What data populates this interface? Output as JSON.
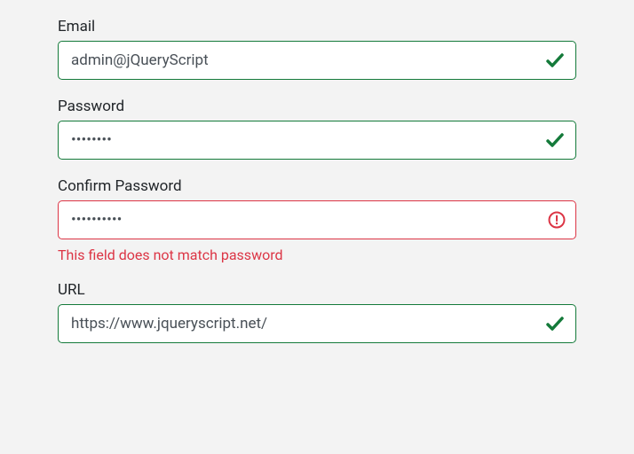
{
  "fields": {
    "email": {
      "label": "Email",
      "value": "admin@jQueryScript"
    },
    "password": {
      "label": "Password",
      "value": "••••••••"
    },
    "confirm_password": {
      "label": "Confirm Password",
      "value": "••••••••••",
      "error": "This field does not match password"
    },
    "url": {
      "label": "URL",
      "value": "https://www.jqueryscript.net/"
    }
  }
}
